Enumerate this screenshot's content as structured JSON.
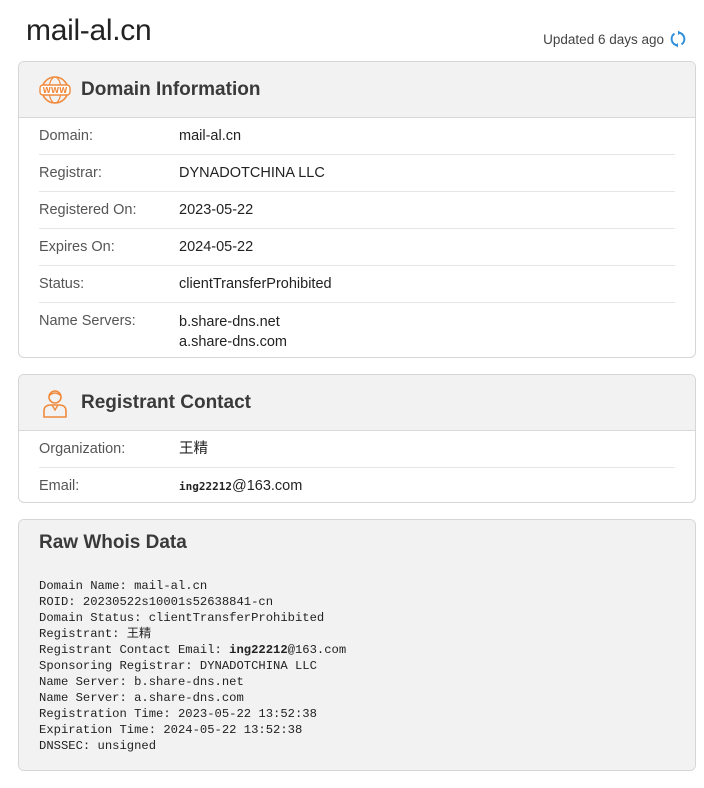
{
  "header": {
    "domain": "mail-al.cn",
    "updated_text": "Updated 6 days ago"
  },
  "domain_info": {
    "title": "Domain Information",
    "icon": "www-globe-icon",
    "rows": {
      "domain": {
        "label": "Domain:",
        "value": "mail-al.cn"
      },
      "registrar": {
        "label": "Registrar:",
        "value": "DYNADOTCHINA LLC"
      },
      "registered_on": {
        "label": "Registered On:",
        "value": "2023-05-22"
      },
      "expires_on": {
        "label": "Expires On:",
        "value": "2024-05-22"
      },
      "status": {
        "label": "Status:",
        "value": "clientTransferProhibited"
      },
      "name_servers": {
        "label": "Name Servers:",
        "values": [
          "b.share-dns.net",
          "a.share-dns.com"
        ]
      }
    }
  },
  "registrant": {
    "title": "Registrant Contact",
    "icon": "person-icon",
    "rows": {
      "organization": {
        "label": "Organization:",
        "value": "王精"
      },
      "email": {
        "label": "Email:",
        "user": "ing22212",
        "domain": "@163.com"
      }
    }
  },
  "raw": {
    "title": "Raw Whois Data",
    "lines": [
      "Domain Name: mail-al.cn",
      "ROID: 20230522s10001s52638841-cn",
      "Domain Status: clientTransferProhibited",
      "Registrant: 王精",
      "Registrant Contact Email: ",
      "Sponsoring Registrar: DYNADOTCHINA LLC",
      "Name Server: b.share-dns.net",
      "Name Server: a.share-dns.com",
      "Registration Time: 2023-05-22 13:52:38",
      "Expiration Time: 2024-05-22 13:52:38",
      "DNSSEC: unsigned"
    ],
    "email_user": "ing22212",
    "email_domain": "@163.com"
  },
  "colors": {
    "accent_orange": "#f08a3c",
    "refresh_blue": "#2f8fdd"
  }
}
